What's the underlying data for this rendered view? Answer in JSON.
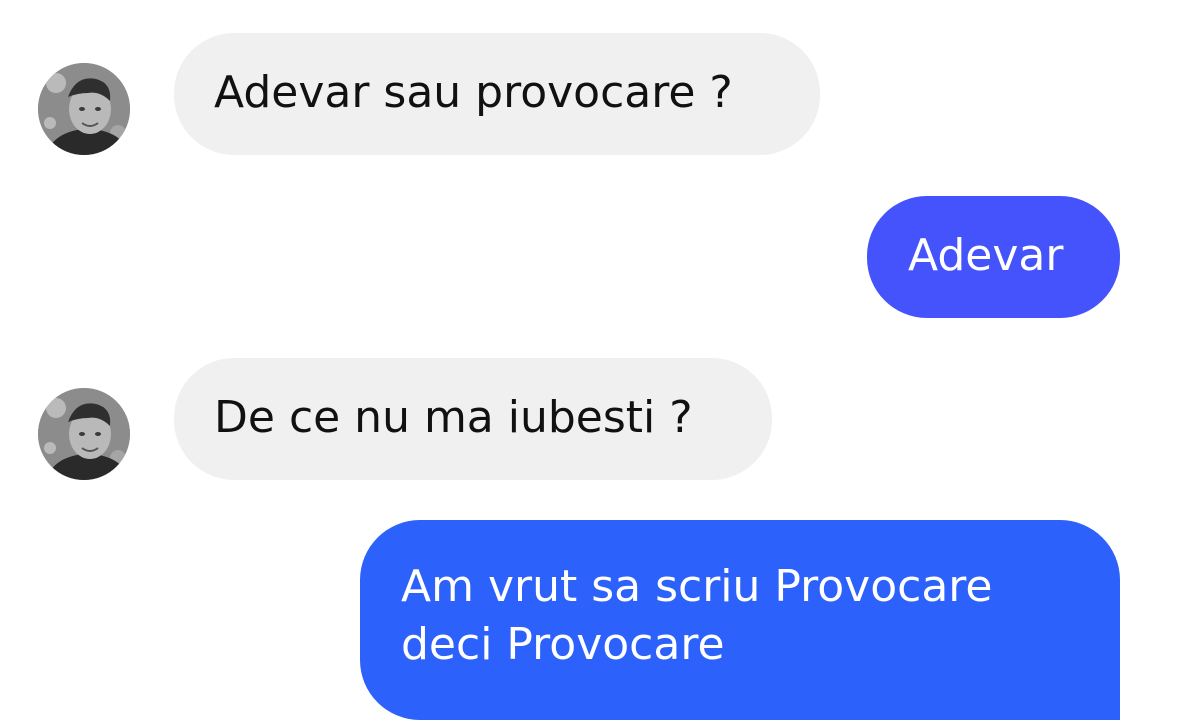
{
  "messages": [
    {
      "sender": "contact",
      "text": "Adevar sau provocare ?"
    },
    {
      "sender": "me",
      "text": "Adevar"
    },
    {
      "sender": "contact",
      "text": "De ce nu ma iubesti ?"
    },
    {
      "sender": "me",
      "text": "Am vrut sa scriu Provocare deci Provocare"
    }
  ],
  "colors": {
    "incoming_bubble": "#f0f0f0",
    "outgoing_bubble": "#3b5bff",
    "background": "#ffffff"
  },
  "icons": {
    "contact_avatar": "contact-avatar"
  }
}
